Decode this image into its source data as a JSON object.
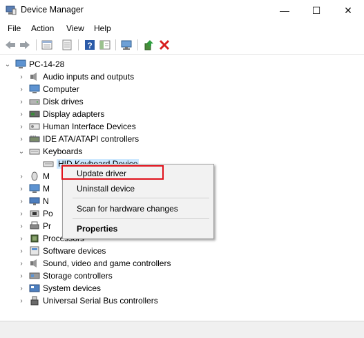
{
  "window": {
    "title": "Device Manager",
    "minimize": "—",
    "maximize": "☐",
    "close": "✕"
  },
  "menu": [
    "File",
    "Action",
    "View",
    "Help"
  ],
  "tree": {
    "root": "PC-14-28",
    "items": [
      "Audio inputs and outputs",
      "Computer",
      "Disk drives",
      "Display adapters",
      "Human Interface Devices",
      "IDE ATA/ATAPI controllers",
      "Keyboards",
      "HID Keyboard Device",
      "M",
      "M",
      "N",
      "Po",
      "Pr",
      "Processors",
      "Software devices",
      "Sound, video and game controllers",
      "Storage controllers",
      "System devices",
      "Universal Serial Bus controllers"
    ]
  },
  "context_menu": {
    "update_driver": "Update driver",
    "uninstall": "Uninstall device",
    "scan": "Scan for hardware changes",
    "properties": "Properties"
  },
  "colors": {
    "highlight_box": "#e0111b",
    "selection": "#cce8ff"
  }
}
